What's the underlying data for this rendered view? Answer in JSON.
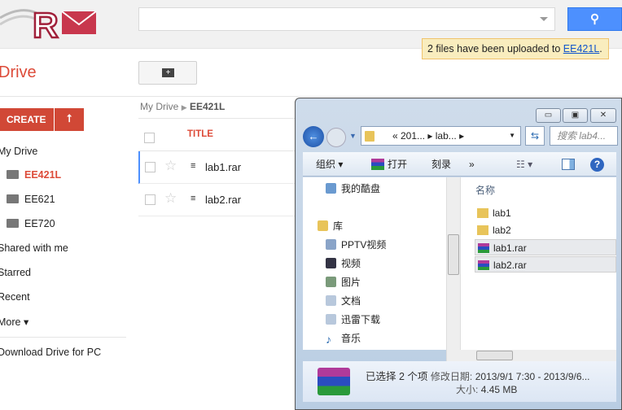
{
  "header": {
    "search_placeholder": "",
    "notice_text": "2 files have been uploaded to ",
    "notice_link": "EE421L",
    "notice_end": "."
  },
  "app": {
    "title": "Drive"
  },
  "sidebar": {
    "create": "CREATE",
    "items": [
      {
        "label": "My Drive"
      },
      {
        "label": "EE421L"
      },
      {
        "label": "EE621"
      },
      {
        "label": "EE720"
      },
      {
        "label": "Shared with me"
      },
      {
        "label": "Starred"
      },
      {
        "label": "Recent"
      },
      {
        "label": "More ▾"
      }
    ],
    "download": "Download Drive for PC"
  },
  "breadcrumb": {
    "root": "My Drive",
    "current": "EE421L"
  },
  "list": {
    "header": "TITLE",
    "files": [
      {
        "name": "lab1.rar"
      },
      {
        "name": "lab2.rar"
      }
    ]
  },
  "explorer": {
    "address": "«  201...  ▸  lab...  ▸",
    "search": "搜索 lab4...",
    "toolbar": {
      "organize": "组织 ▾",
      "open": "打开",
      "burn": "刻录",
      "more": "»"
    },
    "tree": [
      {
        "label": "我的酷盘"
      },
      {
        "label": "库"
      },
      {
        "label": "PPTV视频"
      },
      {
        "label": "视频"
      },
      {
        "label": "图片"
      },
      {
        "label": "文档"
      },
      {
        "label": "迅雷下载"
      },
      {
        "label": "音乐"
      }
    ],
    "column": "名称",
    "items": [
      {
        "name": "lab1"
      },
      {
        "name": "lab2"
      },
      {
        "name": "lab1.rar"
      },
      {
        "name": "lab2.rar"
      }
    ],
    "details": {
      "selected": "已选择 2 个项",
      "modified_label": "修改日期:",
      "modified": "2013/9/1 7:30 - 2013/9/6...",
      "size_label": "大小:",
      "size": "4.45 MB"
    }
  }
}
